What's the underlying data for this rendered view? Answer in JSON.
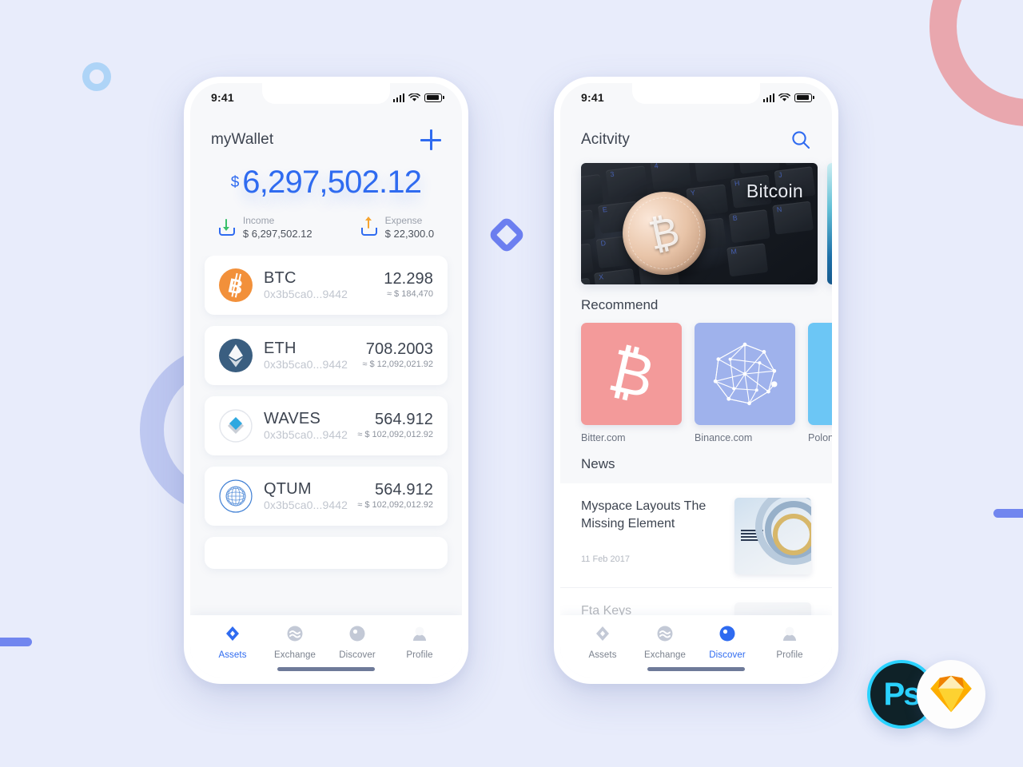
{
  "canvas": {
    "background": "#e8ecfb"
  },
  "decor": {
    "ring_pink": "#e9a7ae",
    "ring_small_blue": "#aed4f7",
    "ring_periwinkle": "#bcc6f0",
    "diamond_outline": "#6c7ff0",
    "bar_blue": "#7186ef"
  },
  "accent": {
    "blue": "#2f6bf0",
    "text_dark": "#3d4450",
    "text_muted": "#9aa0ab"
  },
  "phone1": {
    "status": {
      "time": "9:41",
      "signal_icon": "cellular-bars-icon",
      "wifi_icon": "wifi-icon",
      "battery_icon": "battery-icon"
    },
    "header": {
      "title": "myWallet",
      "add_icon": "plus-icon"
    },
    "balance": {
      "currency": "$",
      "amount": "6,297,502.12"
    },
    "income": {
      "icon": "income-arrow-down-icon",
      "label": "Income",
      "value": "$ 6,297,502.12",
      "arrow_color": "#39c06a"
    },
    "expense": {
      "icon": "expense-arrow-up-icon",
      "label": "Expense",
      "value": "$ 22,300.0",
      "arrow_color": "#f5a431"
    },
    "assets": [
      {
        "icon": "bitcoin-coin-icon",
        "symbol": "BTC",
        "address": "0x3b5ca0...9442",
        "amount": "12.298",
        "usd": "≈ $ 184,470",
        "color": "#f2903a"
      },
      {
        "icon": "ethereum-coin-icon",
        "symbol": "ETH",
        "address": "0x3b5ca0...9442",
        "amount": "708.2003",
        "usd": "≈ $ 12,092,021.92",
        "color": "#3a5e80"
      },
      {
        "icon": "waves-coin-icon",
        "symbol": "WAVES",
        "address": "0x3b5ca0...9442",
        "amount": "564.912",
        "usd": "≈ $ 102,092,012.92",
        "color": "#2fa8e0"
      },
      {
        "icon": "qtum-coin-icon",
        "symbol": "QTUM",
        "address": "0x3b5ca0...9442",
        "amount": "564.912",
        "usd": "≈ $ 102,092,012.92",
        "color": "#3f7fd4"
      }
    ],
    "tabs": [
      {
        "icon": "assets-diamond-icon",
        "label": "Assets",
        "active": true
      },
      {
        "icon": "exchange-waves-icon",
        "label": "Exchange",
        "active": false
      },
      {
        "icon": "discover-compass-icon",
        "label": "Discover",
        "active": false
      },
      {
        "icon": "profile-person-icon",
        "label": "Profile",
        "active": false
      }
    ]
  },
  "phone2": {
    "status": {
      "time": "9:41",
      "signal_icon": "cellular-bars-icon",
      "wifi_icon": "wifi-icon",
      "battery_icon": "battery-icon"
    },
    "header": {
      "title": "Acitvity",
      "search_icon": "search-icon"
    },
    "hero": [
      {
        "caption": "Bitcoin",
        "theme": "bitcoin-keyboard-photo"
      },
      {
        "caption": "",
        "theme": "abstract-teal-photo"
      }
    ],
    "recommend": {
      "title": "Recommend",
      "items": [
        {
          "label": "Bitter.com",
          "color": "#f39a9a",
          "icon": "bitcoin-glyph-icon"
        },
        {
          "label": "Binance.com",
          "color": "#9fb2ec",
          "icon": "network-graph-icon"
        },
        {
          "label": "Polonie",
          "color": "#6cc6f5",
          "icon": "star-icon"
        }
      ]
    },
    "news": {
      "title": "News",
      "items": [
        {
          "headline": "Myspace Layouts The Missing Element",
          "date": "11 Feb 2017",
          "thumb": "ibm-server-photo"
        },
        {
          "headline": "Fta Keys",
          "date": "",
          "thumb": "portrait-avatar-photo"
        }
      ]
    },
    "tabs": [
      {
        "icon": "assets-diamond-icon",
        "label": "Assets",
        "active": false
      },
      {
        "icon": "exchange-waves-icon",
        "label": "Exchange",
        "active": false
      },
      {
        "icon": "discover-compass-icon",
        "label": "Discover",
        "active": true
      },
      {
        "icon": "profile-person-icon",
        "label": "Profile",
        "active": false
      }
    ]
  },
  "badges": [
    {
      "name": "photoshop-badge",
      "label": "Ps"
    },
    {
      "name": "sketch-badge",
      "label": ""
    }
  ]
}
